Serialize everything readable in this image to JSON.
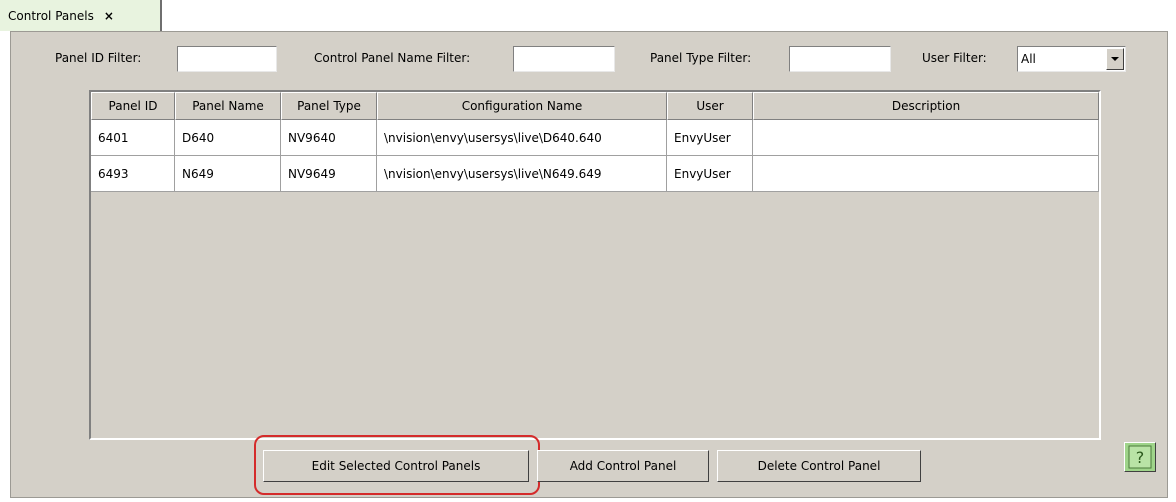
{
  "tab": {
    "label": "Control Panels",
    "close_glyph": "×"
  },
  "filters": {
    "panel_id_label": "Panel ID Filter:",
    "panel_id_value": "",
    "name_label": "Control Panel Name Filter:",
    "name_value": "",
    "type_label": "Panel Type Filter:",
    "type_value": "",
    "user_label": "User Filter:",
    "user_value": "All"
  },
  "table": {
    "columns": [
      "Panel ID",
      "Panel Name",
      "Panel Type",
      "Configuration Name",
      "User",
      "Description"
    ],
    "rows": [
      [
        "6401",
        "D640",
        "NV9640",
        "\\nvision\\envy\\usersys\\live\\D640.640",
        "EnvyUser",
        ""
      ],
      [
        "6493",
        "N649",
        "NV9649",
        "\\nvision\\envy\\usersys\\live\\N649.649",
        "EnvyUser",
        ""
      ]
    ]
  },
  "buttons": {
    "edit": "Edit Selected Control Panels",
    "add": "Add Control Panel",
    "delete": "Delete Control Panel"
  },
  "icons": {
    "help": "help-icon"
  },
  "colors": {
    "highlight": "#d42b2b",
    "tab_bg": "#e8f3df",
    "panel_bg": "#d4d0c8"
  }
}
